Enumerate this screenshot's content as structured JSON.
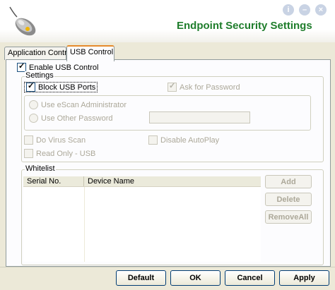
{
  "header": {
    "title": "Endpoint Security Settings",
    "icons": [
      "mouse-icon",
      "info-icon",
      "minimize-icon",
      "close-icon"
    ],
    "title_color": "#1f7d2c",
    "info_button": "i",
    "minimize_button": "–",
    "close_button": "×"
  },
  "tabs": [
    {
      "label": "Application Control",
      "active": false
    },
    {
      "label": "USB Control",
      "active": true
    }
  ],
  "usb": {
    "enable_label": "Enable USB Control",
    "enable_checked": true,
    "settings_title": "Settings",
    "block_label": "Block USB Ports",
    "block_checked": true,
    "ask_password_label": "Ask for Password",
    "ask_password_checked": true,
    "use_admin_label": "Use eScan Administrator",
    "use_other_label": "Use Other Password",
    "password_value": "",
    "virus_scan_label": "Do Virus Scan",
    "disable_autoplay_label": "Disable AutoPlay",
    "read_only_label": "Read Only - USB"
  },
  "whitelist": {
    "title": "Whitelist",
    "columns": [
      "Serial No.",
      "Device Name"
    ],
    "rows": [],
    "add_label": "Add",
    "delete_label": "Delete",
    "remove_all_label": "RemoveAll"
  },
  "footer": {
    "default_label": "Default",
    "ok_label": "OK",
    "cancel_label": "Cancel",
    "apply_label": "Apply"
  }
}
